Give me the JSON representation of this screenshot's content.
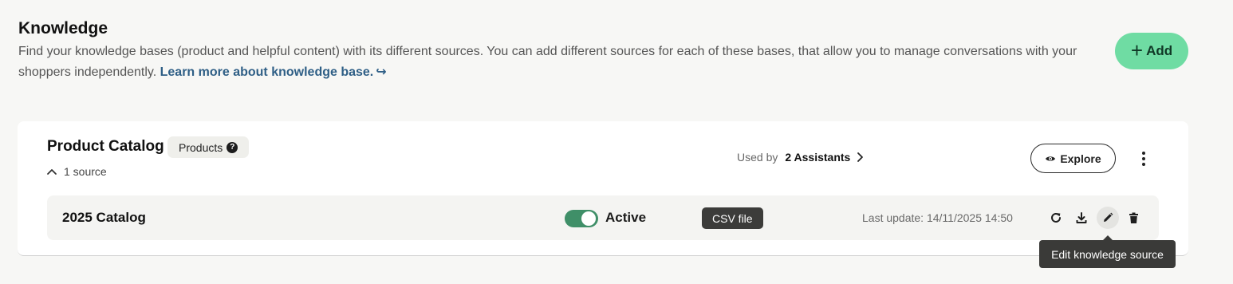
{
  "header": {
    "title": "Knowledge",
    "description": "Find your knowledge bases (product and helpful content) with its different sources. You can add different sources for each of these bases, that allow you to manage conversations with your shoppers independently.",
    "learn_more": "Learn more about knowledge base.",
    "learn_more_arrow": "↪",
    "add_label": "Add"
  },
  "knowledge_base": {
    "title": "Product Catalog",
    "badge": "Products",
    "help_glyph": "?",
    "sources_count": "1 source",
    "used_by_label": "Used by",
    "used_by_value": "2 Assistants",
    "explore_label": "Explore"
  },
  "source": {
    "name": "2025 Catalog",
    "enabled": true,
    "status": "Active",
    "type": "CSV file",
    "last_update": "Last update: 14/11/2025 14:50",
    "actions": [
      "refresh-icon",
      "download-icon",
      "edit-icon",
      "trash-icon"
    ]
  },
  "tooltip": {
    "text": "Edit knowledge source"
  },
  "colors": {
    "accent": "#6fdca3",
    "toggle_on": "#3f8f68",
    "link": "#2f5f86",
    "tooltip_bg": "#3a3a38"
  }
}
